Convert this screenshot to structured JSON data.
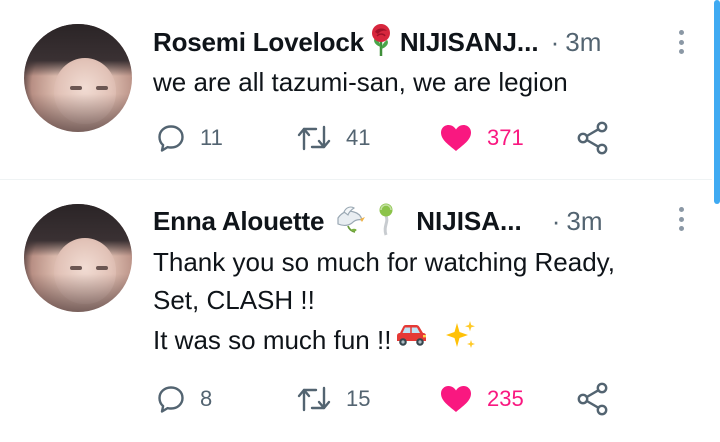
{
  "tweets": [
    {
      "author": "Rosemi Lovelock",
      "affiliation": "NIJISANJ...",
      "separator": "·",
      "time": "3m",
      "lines": [
        "we are all tazumi-san, we are legion"
      ],
      "stats": {
        "replies": "11",
        "retweets": "41",
        "likes": "371"
      },
      "icons": [
        "reply-icon",
        "retweet-icon",
        "heart-icon",
        "share-icon"
      ]
    },
    {
      "author": "Enna Alouette",
      "affiliation": "NIJISA...",
      "separator": "·",
      "time": "3m",
      "lines": [
        "Thank you so much for watching Ready,",
        "Set, CLASH !!",
        "It was so much fun !!"
      ],
      "stats": {
        "replies": "8",
        "retweets": "15",
        "likes": "235"
      },
      "icons": [
        "reply-icon",
        "retweet-icon",
        "heart-icon",
        "share-icon"
      ]
    }
  ],
  "colors": {
    "like": "#f91880",
    "muted": "#536471",
    "text": "#0f1419",
    "accent": "#1d9bf0"
  }
}
